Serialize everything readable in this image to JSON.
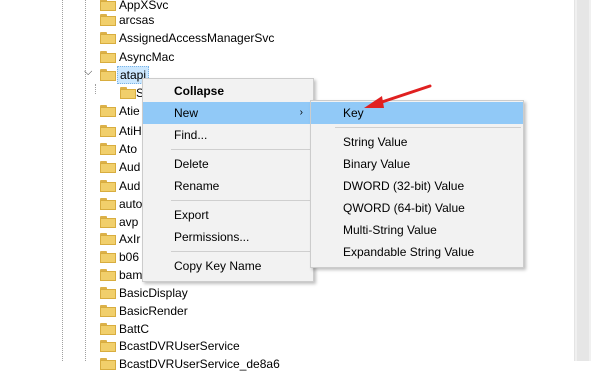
{
  "tree": {
    "items": [
      {
        "label": "AppXSvc"
      },
      {
        "label": "arcsas"
      },
      {
        "label": "AssignedAccessManagerSvc"
      },
      {
        "label": "AsyncMac"
      },
      {
        "label": "atapi"
      },
      {
        "label": "S"
      },
      {
        "label": "Atie"
      },
      {
        "label": "AtiH"
      },
      {
        "label": "Ato"
      },
      {
        "label": "Aud"
      },
      {
        "label": "Aud"
      },
      {
        "label": "auto"
      },
      {
        "label": "avp"
      },
      {
        "label": "AxIr"
      },
      {
        "label": "b06"
      },
      {
        "label": "bam"
      },
      {
        "label": "BasicDisplay"
      },
      {
        "label": "BasicRender"
      },
      {
        "label": "BattC"
      },
      {
        "label": "BcastDVRUserService"
      },
      {
        "label": "BcastDVRUserService_de8a6"
      }
    ]
  },
  "context_menu": {
    "collapse": "Collapse",
    "new": "New",
    "find": "Find...",
    "delete": "Delete",
    "rename": "Rename",
    "export": "Export",
    "permissions": "Permissions...",
    "copy_key_name": "Copy Key Name"
  },
  "submenu": {
    "key": "Key",
    "string_value": "String Value",
    "binary_value": "Binary Value",
    "dword_value": "DWORD (32-bit) Value",
    "qword_value": "QWORD (64-bit) Value",
    "multi_string_value": "Multi-String Value",
    "expandable_string_value": "Expandable String Value"
  },
  "colors": {
    "highlight": "#91c9f7",
    "annotation_arrow": "#e02020",
    "folder": "#f1cf6b"
  }
}
